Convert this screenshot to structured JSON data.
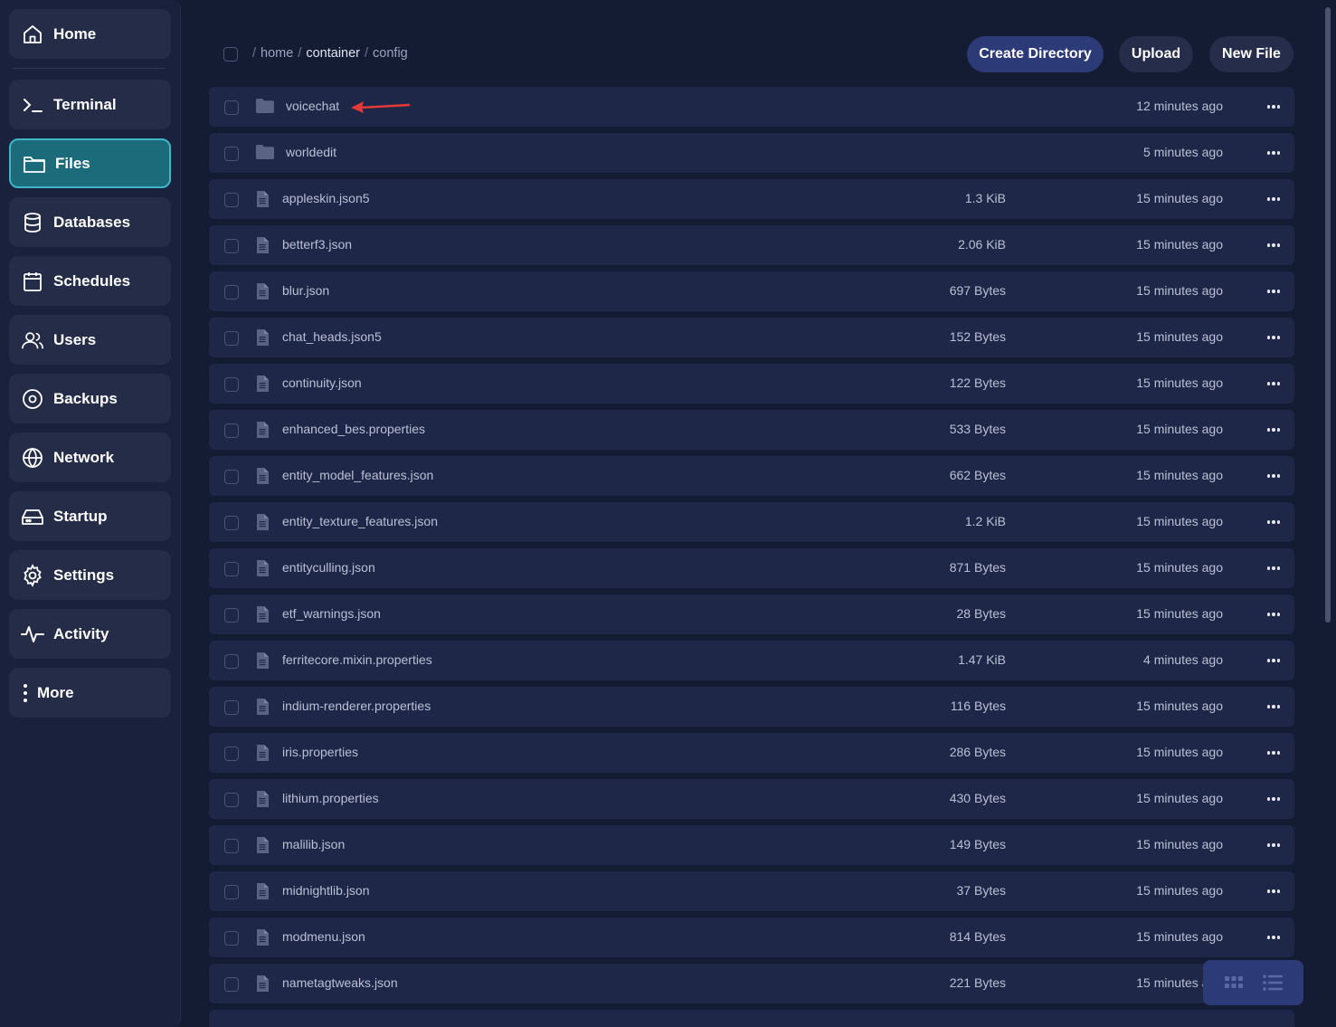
{
  "sidebar": {
    "items": [
      {
        "label": "Home",
        "icon": "home-icon",
        "active": false
      },
      {
        "label": "Terminal",
        "icon": "terminal-icon",
        "active": false
      },
      {
        "label": "Files",
        "icon": "folder-icon",
        "active": true
      },
      {
        "label": "Databases",
        "icon": "database-icon",
        "active": false
      },
      {
        "label": "Schedules",
        "icon": "calendar-icon",
        "active": false
      },
      {
        "label": "Users",
        "icon": "users-icon",
        "active": false
      },
      {
        "label": "Backups",
        "icon": "backup-icon",
        "active": false
      },
      {
        "label": "Network",
        "icon": "globe-icon",
        "active": false
      },
      {
        "label": "Startup",
        "icon": "drive-icon",
        "active": false
      },
      {
        "label": "Settings",
        "icon": "gear-icon",
        "active": false
      },
      {
        "label": "Activity",
        "icon": "activity-icon",
        "active": false
      },
      {
        "label": "More",
        "icon": "more-vertical-icon",
        "active": false
      }
    ]
  },
  "breadcrumb": {
    "root_sep": "/",
    "home": "home",
    "sep": "/",
    "container": "container",
    "config": "config"
  },
  "toolbar": {
    "create_directory": "Create Directory",
    "upload": "Upload",
    "new_file": "New File"
  },
  "files": [
    {
      "name": "voicechat",
      "type": "dir",
      "size": "",
      "modified": "12 minutes ago"
    },
    {
      "name": "worldedit",
      "type": "dir",
      "size": "",
      "modified": "5 minutes ago"
    },
    {
      "name": "appleskin.json5",
      "type": "file",
      "size": "1.3 KiB",
      "modified": "15 minutes ago"
    },
    {
      "name": "betterf3.json",
      "type": "file",
      "size": "2.06 KiB",
      "modified": "15 minutes ago"
    },
    {
      "name": "blur.json",
      "type": "file",
      "size": "697 Bytes",
      "modified": "15 minutes ago"
    },
    {
      "name": "chat_heads.json5",
      "type": "file",
      "size": "152 Bytes",
      "modified": "15 minutes ago"
    },
    {
      "name": "continuity.json",
      "type": "file",
      "size": "122 Bytes",
      "modified": "15 minutes ago"
    },
    {
      "name": "enhanced_bes.properties",
      "type": "file",
      "size": "533 Bytes",
      "modified": "15 minutes ago"
    },
    {
      "name": "entity_model_features.json",
      "type": "file",
      "size": "662 Bytes",
      "modified": "15 minutes ago"
    },
    {
      "name": "entity_texture_features.json",
      "type": "file",
      "size": "1.2 KiB",
      "modified": "15 minutes ago"
    },
    {
      "name": "entityculling.json",
      "type": "file",
      "size": "871 Bytes",
      "modified": "15 minutes ago"
    },
    {
      "name": "etf_warnings.json",
      "type": "file",
      "size": "28 Bytes",
      "modified": "15 minutes ago"
    },
    {
      "name": "ferritecore.mixin.properties",
      "type": "file",
      "size": "1.47 KiB",
      "modified": "4 minutes ago"
    },
    {
      "name": "indium-renderer.properties",
      "type": "file",
      "size": "116 Bytes",
      "modified": "15 minutes ago"
    },
    {
      "name": "iris.properties",
      "type": "file",
      "size": "286 Bytes",
      "modified": "15 minutes ago"
    },
    {
      "name": "lithium.properties",
      "type": "file",
      "size": "430 Bytes",
      "modified": "15 minutes ago"
    },
    {
      "name": "malilib.json",
      "type": "file",
      "size": "149 Bytes",
      "modified": "15 minutes ago"
    },
    {
      "name": "midnightlib.json",
      "type": "file",
      "size": "37 Bytes",
      "modified": "15 minutes ago"
    },
    {
      "name": "modmenu.json",
      "type": "file",
      "size": "814 Bytes",
      "modified": "15 minutes ago"
    },
    {
      "name": "nametagtweaks.json",
      "type": "file",
      "size": "221 Bytes",
      "modified": "15 minutes ago"
    }
  ],
  "colors": {
    "accent": "#2c3a78",
    "active_nav": "#1c6b7a",
    "arrow": "#e53935"
  }
}
